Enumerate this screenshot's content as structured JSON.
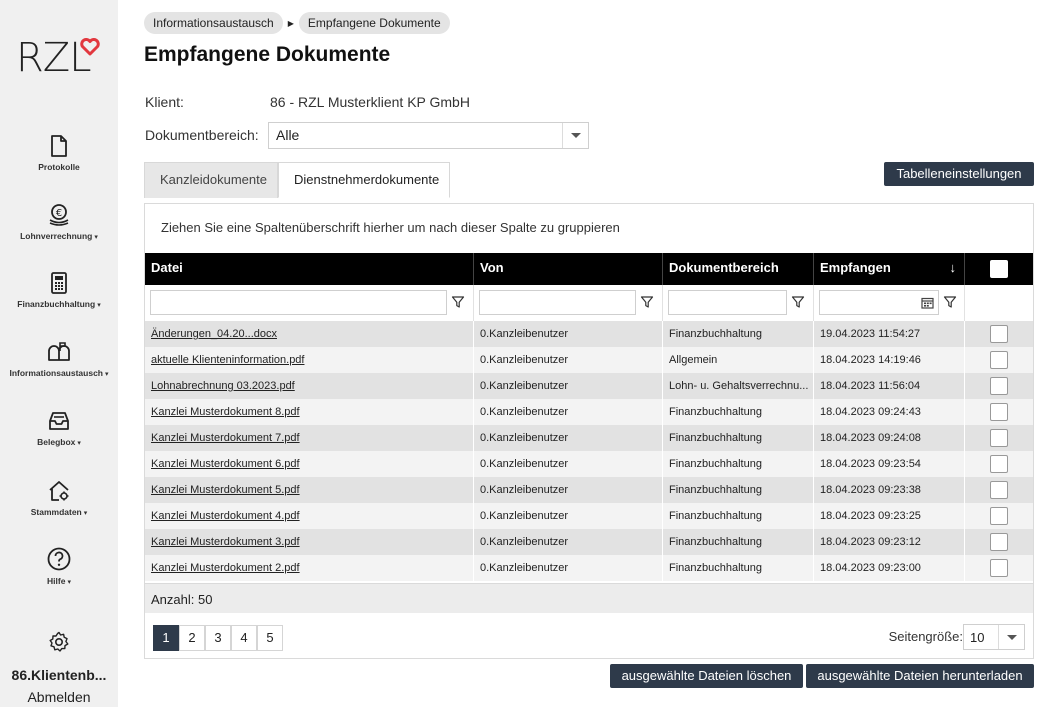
{
  "sidebar": {
    "logo_text": "RZL",
    "items": [
      {
        "label": "Protokolle",
        "icon": "document-icon",
        "has_caret": false
      },
      {
        "label": "Lohnverrechnung",
        "icon": "euro-coins-icon",
        "has_caret": true
      },
      {
        "label": "Finanzbuchhaltung",
        "icon": "calculator-icon",
        "has_caret": true
      },
      {
        "label": "Informationsaustausch",
        "icon": "mailbox-icon",
        "has_caret": true
      },
      {
        "label": "Belegbox",
        "icon": "inbox-tray-icon",
        "has_caret": true
      },
      {
        "label": "Stammdaten",
        "icon": "home-gear-icon",
        "has_caret": true
      },
      {
        "label": "Hilfe",
        "icon": "question-icon",
        "has_caret": true
      }
    ],
    "caret": "▾",
    "settings_icon": "gear-icon",
    "user_name": "86.Klientenb...",
    "logout_label": "Abmelden"
  },
  "breadcrumb": [
    "Informationsaustausch",
    "Empfangene Dokumente"
  ],
  "page_title": "Empfangene Dokumente",
  "client": {
    "label": "Klient:",
    "value": "86 - RZL Musterklient KP GmbH"
  },
  "doc_area": {
    "label": "Dokumentbereich:",
    "value": "Alle"
  },
  "tabs": [
    {
      "label": "Kanzleidokumente",
      "active": false
    },
    {
      "label": "Dienstnehmerdokumente",
      "active": true
    }
  ],
  "table_settings_label": "Tabelleneinstellungen",
  "grid": {
    "group_hint": "Ziehen Sie eine Spaltenüberschrift hierher um nach dieser Spalte zu gruppieren",
    "columns": [
      "Datei",
      "Von",
      "Dokumentbereich",
      "Empfangen"
    ],
    "sort_indicator": "↓",
    "rows": [
      {
        "file": "Änderungen_04.20...docx",
        "from": "0.Kanzleibenutzer",
        "area": "Finanzbuchhaltung",
        "received": "19.04.2023 11:54:27"
      },
      {
        "file": "aktuelle Klienteninformation.pdf",
        "from": "0.Kanzleibenutzer",
        "area": "Allgemein",
        "received": "18.04.2023 14:19:46"
      },
      {
        "file": "Lohnabrechnung 03.2023.pdf",
        "from": "0.Kanzleibenutzer",
        "area": "Lohn- u. Gehaltsverrechnu...",
        "received": "18.04.2023 11:56:04"
      },
      {
        "file": "Kanzlei Musterdokument 8.pdf",
        "from": "0.Kanzleibenutzer",
        "area": "Finanzbuchhaltung",
        "received": "18.04.2023 09:24:43"
      },
      {
        "file": "Kanzlei Musterdokument 7.pdf",
        "from": "0.Kanzleibenutzer",
        "area": "Finanzbuchhaltung",
        "received": "18.04.2023 09:24:08"
      },
      {
        "file": "Kanzlei Musterdokument 6.pdf",
        "from": "0.Kanzleibenutzer",
        "area": "Finanzbuchhaltung",
        "received": "18.04.2023 09:23:54"
      },
      {
        "file": "Kanzlei Musterdokument 5.pdf",
        "from": "0.Kanzleibenutzer",
        "area": "Finanzbuchhaltung",
        "received": "18.04.2023 09:23:38"
      },
      {
        "file": "Kanzlei Musterdokument 4.pdf",
        "from": "0.Kanzleibenutzer",
        "area": "Finanzbuchhaltung",
        "received": "18.04.2023 09:23:25"
      },
      {
        "file": "Kanzlei Musterdokument 3.pdf",
        "from": "0.Kanzleibenutzer",
        "area": "Finanzbuchhaltung",
        "received": "18.04.2023 09:23:12"
      },
      {
        "file": "Kanzlei Musterdokument 2.pdf",
        "from": "0.Kanzleibenutzer",
        "area": "Finanzbuchhaltung",
        "received": "18.04.2023 09:23:00"
      }
    ],
    "count_label": "Anzahl: 50"
  },
  "pager": {
    "pages": [
      "1",
      "2",
      "3",
      "4",
      "5"
    ],
    "active_page": "1",
    "page_size_label": "Seitengröße:",
    "page_size": "10"
  },
  "actions": {
    "delete_label": "ausgewählte Dateien löschen",
    "download_label": "ausgewählte Dateien herunterladen"
  },
  "colors": {
    "accent_dark": "#2e3a4a",
    "logo_heart": "#e2383f",
    "header_bg": "#000000"
  }
}
